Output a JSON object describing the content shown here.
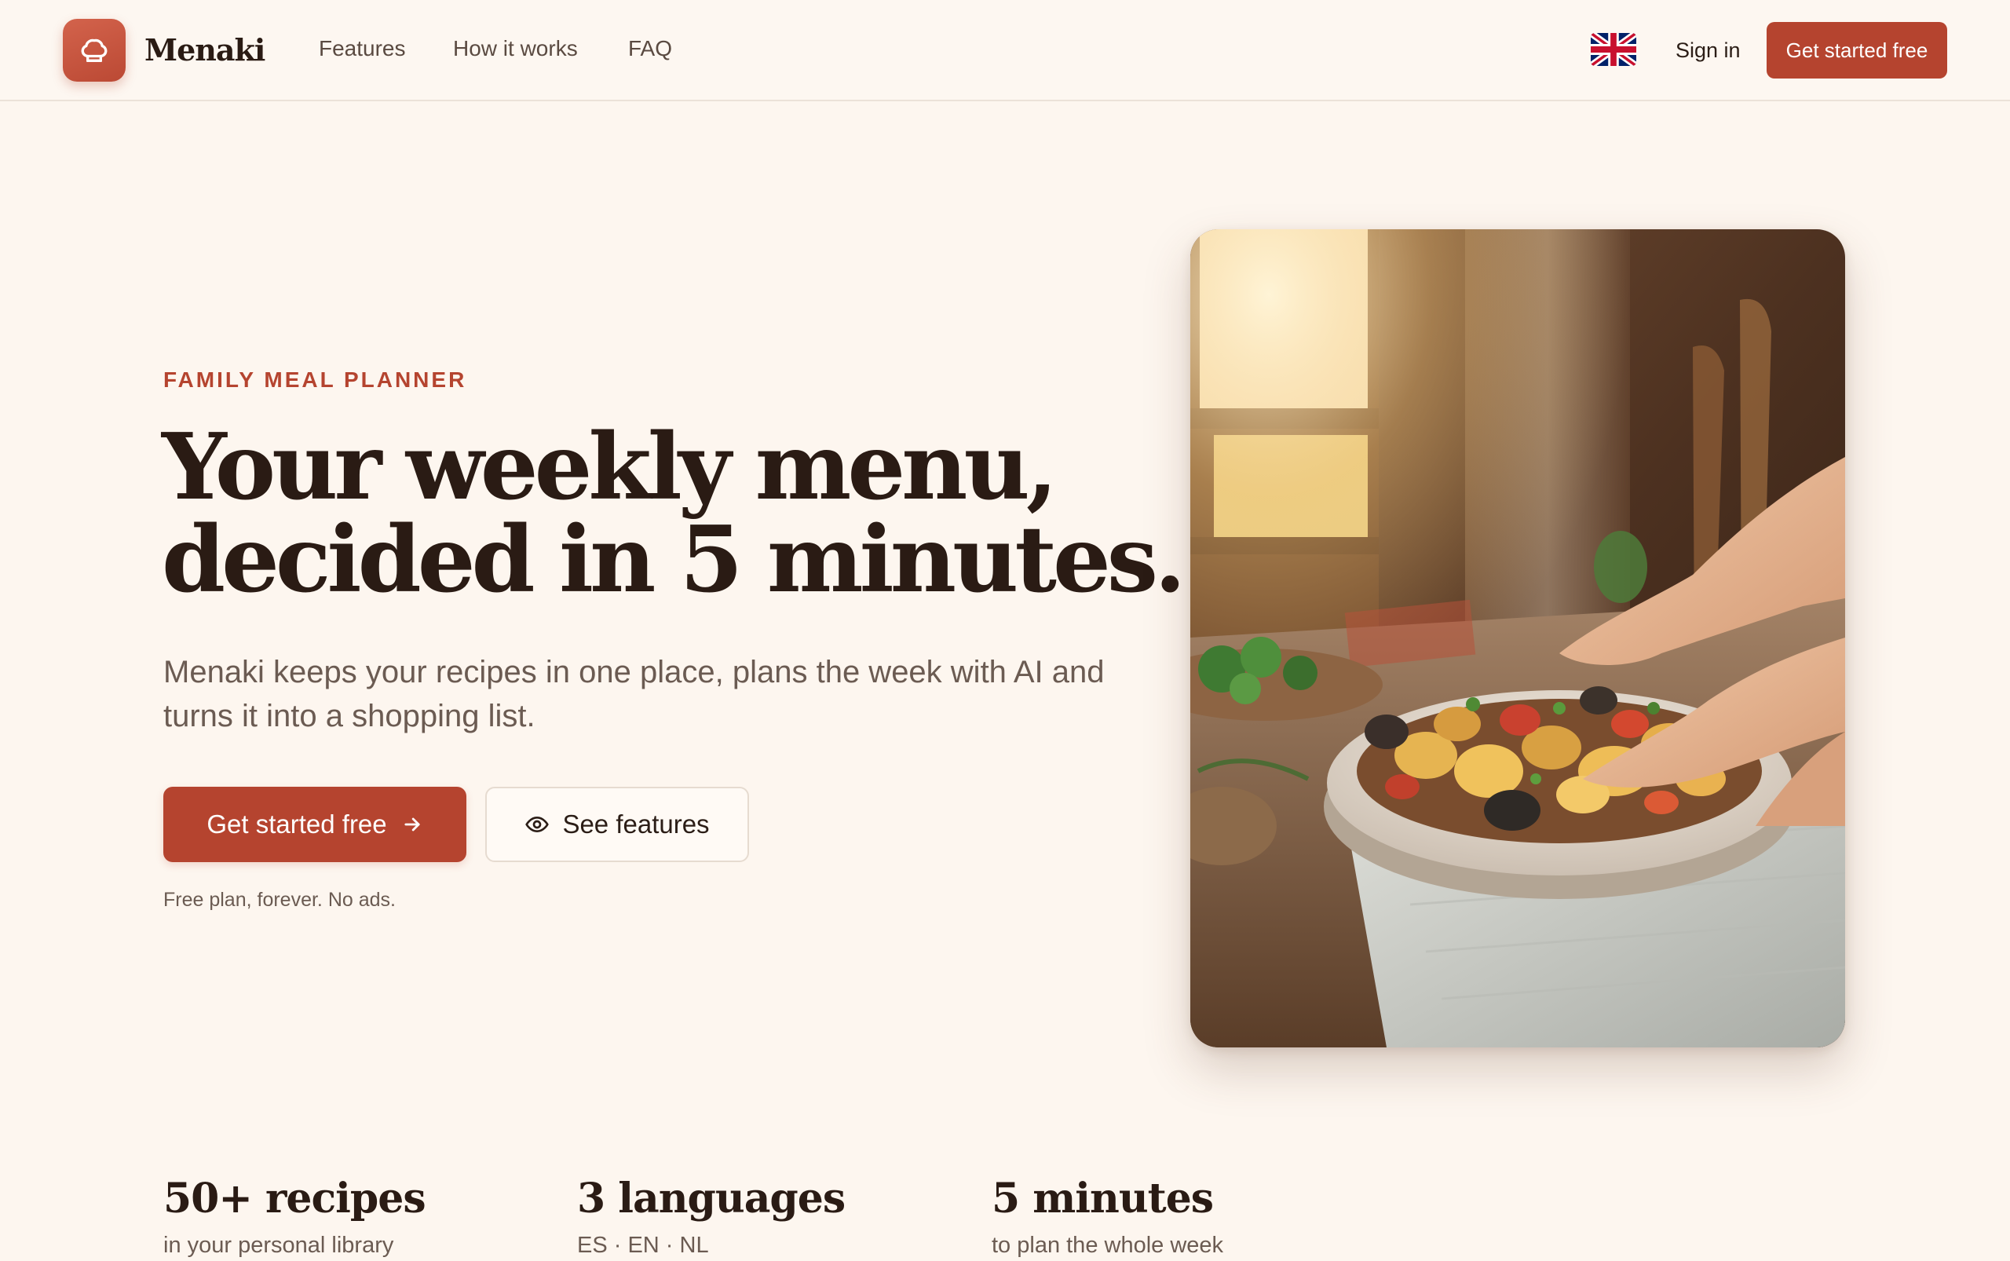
{
  "header": {
    "brand": "Menaki",
    "nav": [
      "Features",
      "How it works",
      "FAQ"
    ],
    "language_icon": "uk-flag-icon",
    "sign_in": "Sign in",
    "cta": "Get started free"
  },
  "hero": {
    "eyebrow": "FAMILY MEAL PLANNER",
    "headline_line1": "Your weekly menu,",
    "headline_line2": "decided in 5 minutes.",
    "subcopy": "Menaki keeps your recipes in one place, plans the week with AI and turns it into a shopping list.",
    "primary_cta": "Get started free",
    "secondary_cta": "See features",
    "fineprint": "Free plan, forever. No ads."
  },
  "stats": [
    {
      "value": "50+ recipes",
      "label": "in your personal library"
    },
    {
      "value": "3 languages",
      "label": "ES · EN · NL"
    },
    {
      "value": "5 minutes",
      "label": "to plan the whole week"
    }
  ],
  "colors": {
    "accent": "#b5442f",
    "background": "#fdf6ef",
    "heading": "#2a1b14",
    "muted": "#6b5b52"
  },
  "icons": {
    "logo": "chef-hat-icon",
    "primary_cta_icon": "arrow-right-icon",
    "secondary_cta_icon": "eye-icon"
  }
}
